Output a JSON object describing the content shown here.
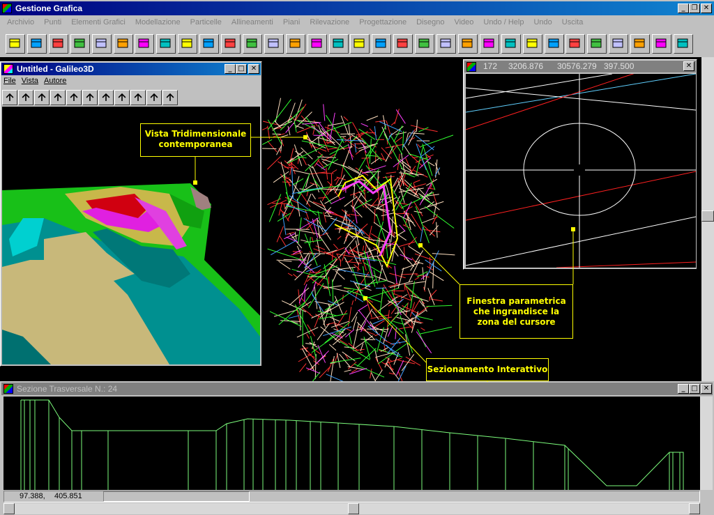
{
  "app": {
    "title": "Gestione Grafica",
    "menu": [
      "Archivio",
      "Punti",
      "Elementi Grafici",
      "Modellazione",
      "Particelle",
      "Allineamenti",
      "Piani",
      "Rilevazione",
      "Progettazione",
      "Disegno",
      "Video",
      "Undo / Help",
      "Undo",
      "Uscita"
    ],
    "toolbar_icons": [
      "new-icon",
      "open-icon",
      "save-icon",
      "open-folder-icon",
      "save-disk-icon",
      "macro-m-icon",
      "points-icon",
      "contour-icon",
      "terrain-icon",
      "map-icon",
      "polyline-icon",
      "solid-icon",
      "grid-icon",
      "profile-icon",
      "table-icon",
      "edit-icon",
      "cross-icon",
      "globe-icon",
      "zoom-icon",
      "bulldozer-icon",
      "hand-icon",
      "zoom-plus-icon",
      "back-arrow-icon",
      "window-icon",
      "list-icon",
      "layers-icon",
      "palette-icon",
      "eraser-icon",
      "undo-icon",
      "snap-icon",
      "export-icon",
      "exit-door-icon"
    ]
  },
  "galileo": {
    "title": "Untitled - Galileo3D",
    "menu": [
      "File",
      "Vista",
      "Autore"
    ]
  },
  "zoom_window": {
    "point": "172",
    "x": "3206.876",
    "y": "30576.279",
    "z": "397.500"
  },
  "section": {
    "title": "Sezione Trasversale N.: 24",
    "status_x": "97.388,",
    "status_y": "405.851"
  },
  "callouts": {
    "vista": "Vista Tridimensionale contemporanea",
    "finestra": "Finestra parametrica che ingrandisce la zona del cursore",
    "sezionamento": "Sezionamento Interattivo"
  },
  "colors": {
    "titlebar": "#000080",
    "callout": "#ffff00",
    "profile_line": "#7cfc7c"
  }
}
